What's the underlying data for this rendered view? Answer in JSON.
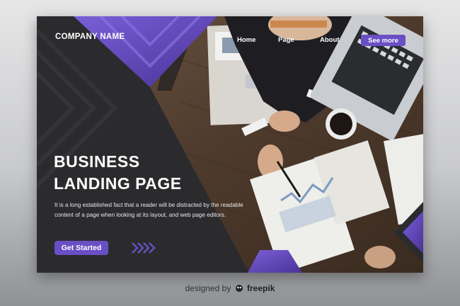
{
  "brand": {
    "name": "COMPANY NAME"
  },
  "nav": {
    "items": [
      {
        "label": "Home"
      },
      {
        "label": "Page"
      },
      {
        "label": "About"
      }
    ],
    "cta_label": "See more"
  },
  "hero": {
    "headline_line1": "BUSINESS",
    "headline_line2": "LANDING PAGE",
    "description": "It is a long established fact that a reader will be distracted by the readable content of a page when looking at its layout, and web page editors.",
    "cta_label": "Get Started"
  },
  "footer": {
    "prefix": "designed by",
    "logo_icon": "freepik-logo-icon",
    "logo_text": "freepik"
  },
  "colors": {
    "accent": "#6a4fc4",
    "dark_panel": "#2b2b2e",
    "background": "#c9cacc"
  }
}
